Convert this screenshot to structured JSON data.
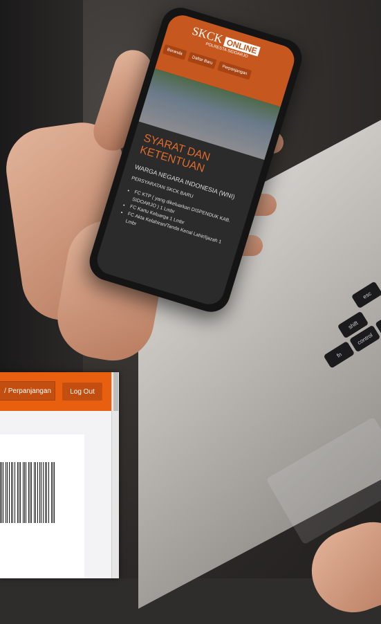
{
  "phone_site": {
    "logo_main": "SKCK",
    "logo_badge": "ONLINE",
    "logo_sub": "POLRESTA SIDOARJO",
    "menu": [
      "Beranda",
      "Daftar Baru",
      "Perpanjangan"
    ],
    "section_title_line1": "SYARAT DAN",
    "section_title_line2": "KETENTUAN",
    "subtitle": "WARGA NEGARA INDONESIA (WNI)",
    "requirements_heading": "PERSYARATAN SKCK BARU",
    "requirements": [
      "FC KTP ( yang dikeluarkan DISPENDUK KAB. SIDOARJO ) 1 Lmbr",
      "FC Kartu Keluarga 1 Lmbr",
      "FC Akta Kelahiran/Tanda Kenal Lahir/Ijazah 1 Lmbr"
    ]
  },
  "keyboard": {
    "keys": [
      "esc",
      "shift",
      "fn",
      "control",
      "option"
    ]
  },
  "browser": {
    "nav": {
      "perpanjangan_label": "/ Perpanjangan",
      "logout_label": "Log Out"
    }
  },
  "colors": {
    "brand_orange": "#e8600f",
    "button_dark_orange": "#c24e10"
  }
}
